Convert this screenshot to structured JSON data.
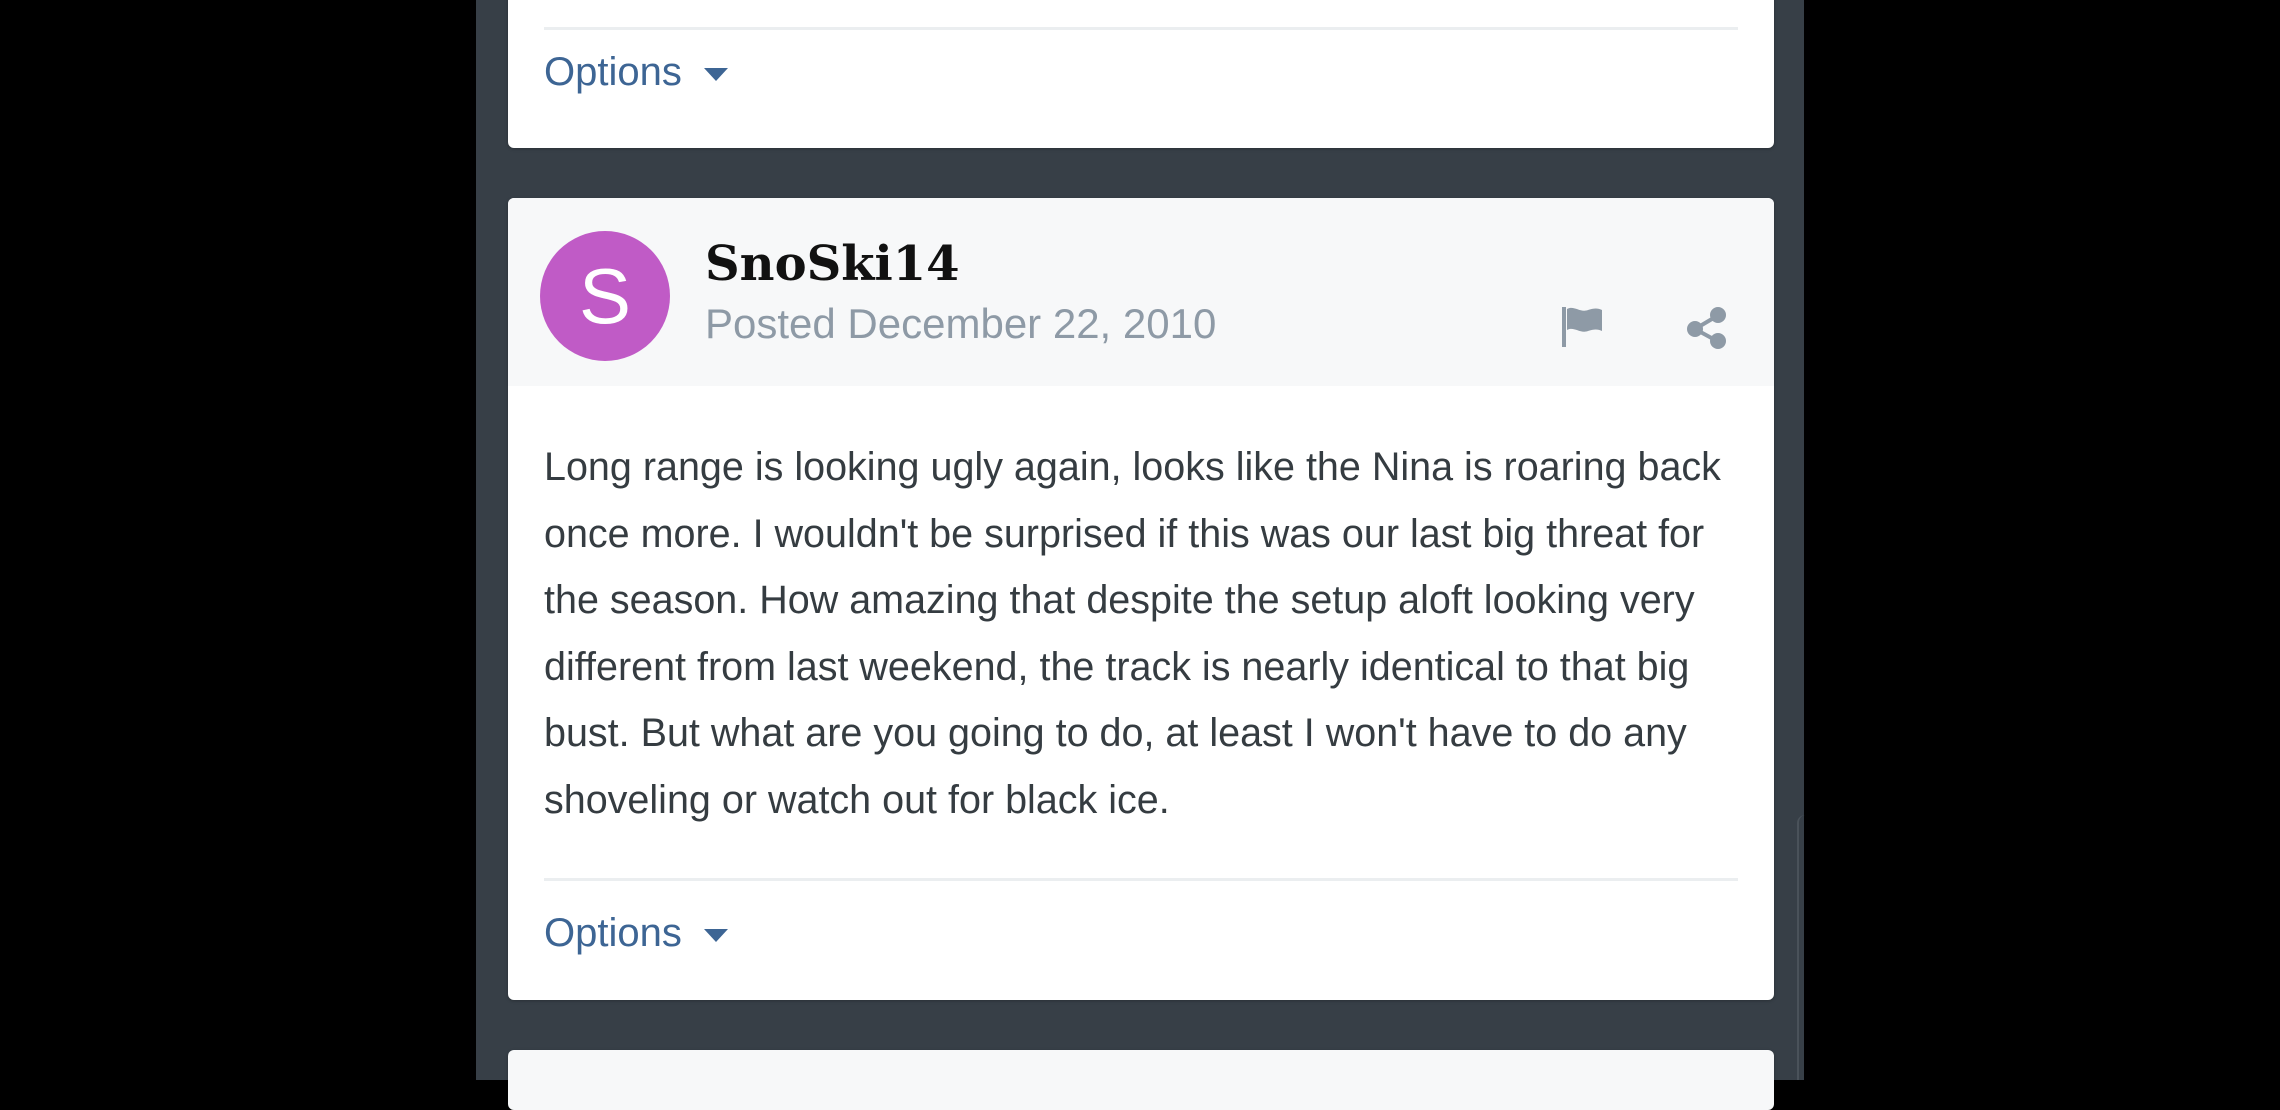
{
  "previous_post": {
    "options_label": "Options"
  },
  "post": {
    "avatar_letter": "S",
    "avatar_color": "#c05bc6",
    "author": "SnoSki14",
    "posted": "Posted December 22, 2010",
    "icons": [
      "flag-icon",
      "share-icon"
    ],
    "body": "Long range is looking ugly again, looks like the Nina is roaring back once more. I wouldn't be surprised if this was our last big threat for the season. How amazing that despite the setup aloft looking very different from last weekend, the track is nearly identical to that big bust. But what are you going to do, at least I won't have to do any shoveling or watch out for black ice.",
    "options_label": "Options"
  },
  "colors": {
    "page_background": "#000000",
    "column_background": "#373f47",
    "link": "#3d6594",
    "meta_text": "#8e9aa6"
  }
}
